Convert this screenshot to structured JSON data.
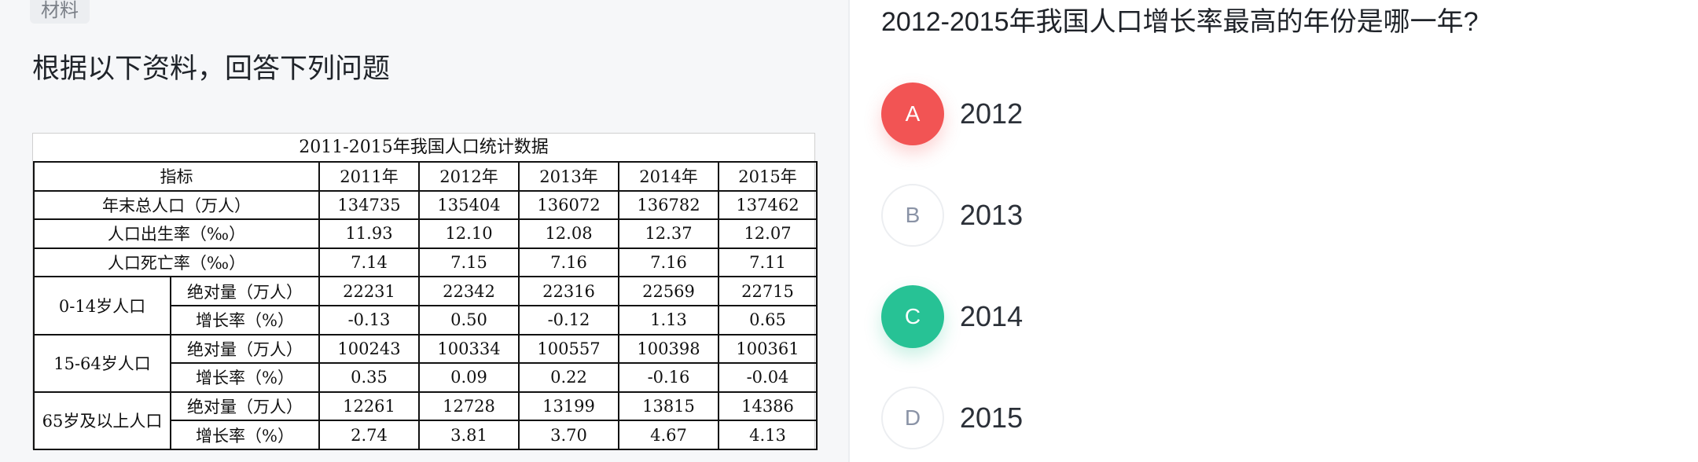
{
  "material": {
    "tag": "材料",
    "instruction": "根据以下资料，回答下列问题"
  },
  "table": {
    "title": "2011-2015年我国人口统计数据",
    "header": [
      "指标",
      "2011年",
      "2012年",
      "2013年",
      "2014年",
      "2015年"
    ],
    "rows": [
      {
        "label": "年末总人口（万人）",
        "values": [
          "134735",
          "135404",
          "136072",
          "136782",
          "137462"
        ]
      },
      {
        "label": "人口出生率（‰）",
        "values": [
          "11.93",
          "12.10",
          "12.08",
          "12.37",
          "12.07"
        ]
      },
      {
        "label": "人口死亡率（‰）",
        "values": [
          "7.14",
          "7.15",
          "7.16",
          "7.16",
          "7.11"
        ]
      }
    ],
    "groups": [
      {
        "label": "0-14岁人口",
        "abs_label": "绝对量（万人）",
        "abs_values": [
          "22231",
          "22342",
          "22316",
          "22569",
          "22715"
        ],
        "rate_label": "增长率（%）",
        "rate_values": [
          "-0.13",
          "0.50",
          "-0.12",
          "1.13",
          "0.65"
        ]
      },
      {
        "label": "15-64岁人口",
        "abs_label": "绝对量（万人）",
        "abs_values": [
          "100243",
          "100334",
          "100557",
          "100398",
          "100361"
        ],
        "rate_label": "增长率（%）",
        "rate_values": [
          "0.35",
          "0.09",
          "0.22",
          "-0.16",
          "-0.04"
        ]
      },
      {
        "label": "65岁及以上人口",
        "abs_label": "绝对量（万人）",
        "abs_values": [
          "12261",
          "12728",
          "13199",
          "13815",
          "14386"
        ],
        "rate_label": "增长率（%）",
        "rate_values": [
          "2.74",
          "3.81",
          "3.70",
          "4.67",
          "4.13"
        ]
      }
    ]
  },
  "question": {
    "text": "2012-2015年我国人口增长率最高的年份是哪一年?",
    "options": [
      {
        "letter": "A",
        "text": "2012",
        "state": "wrong"
      },
      {
        "letter": "B",
        "text": "2013",
        "state": "plain"
      },
      {
        "letter": "C",
        "text": "2014",
        "state": "right"
      },
      {
        "letter": "D",
        "text": "2015",
        "state": "plain"
      }
    ]
  },
  "colors": {
    "wrong": "#f25454",
    "right": "#27c295",
    "neutral_letter": "#8a93a6",
    "left_bg": "#f6f7f9"
  }
}
